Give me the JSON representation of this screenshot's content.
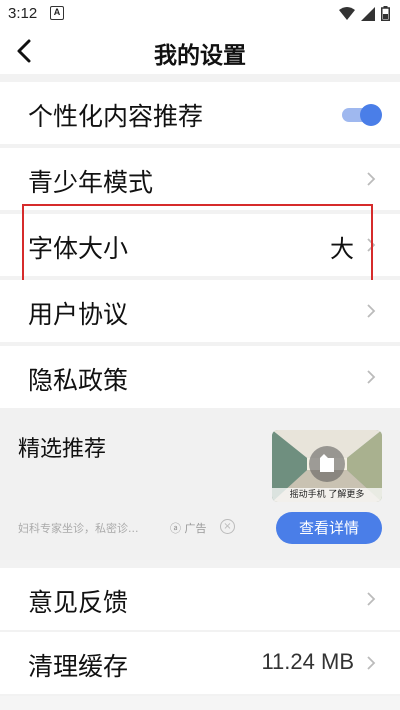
{
  "status_bar": {
    "time": "3:12",
    "notification_letter": "A"
  },
  "header": {
    "title": "我的设置"
  },
  "settings": {
    "personalized": {
      "label": "个性化内容推荐",
      "toggle_on": true
    },
    "youth_mode": {
      "label": "青少年模式"
    },
    "font_size": {
      "label": "字体大小",
      "value": "大"
    },
    "user_agreement": {
      "label": "用户协议"
    },
    "privacy_policy": {
      "label": "隐私政策"
    },
    "feedback": {
      "label": "意见反馈"
    },
    "clear_cache": {
      "label": "清理缓存",
      "value": "11.24 MB"
    }
  },
  "ad": {
    "title": "精选推荐",
    "image_caption": "摇动手机 了解更多",
    "description": "妇科专家坐诊，私密诊...",
    "badge": "广告",
    "close_symbol": "×",
    "button_label": "查看详情"
  },
  "colors": {
    "accent": "#4a7ee8",
    "highlight": "#d62b2b"
  }
}
